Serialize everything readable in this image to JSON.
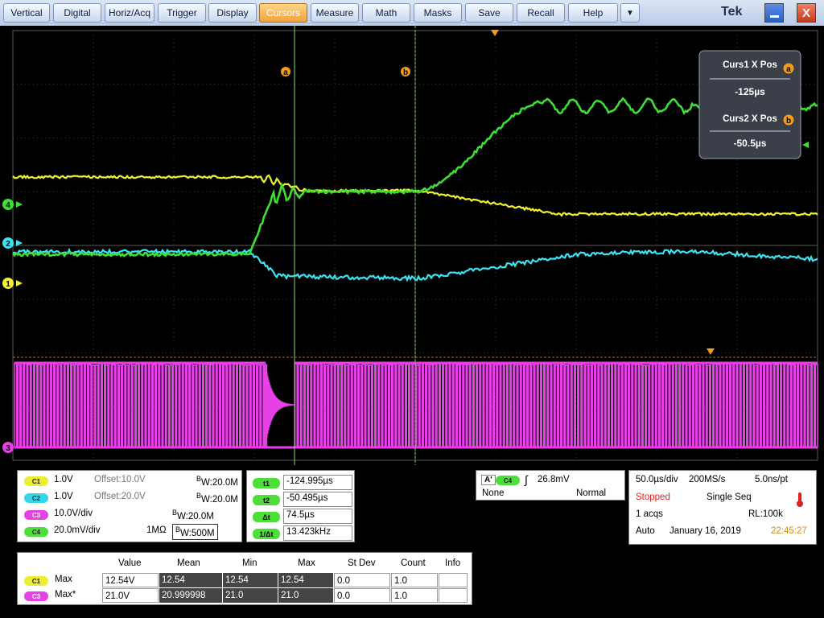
{
  "menu": {
    "items": [
      "Vertical",
      "Digital",
      "Horiz/Acq",
      "Trigger",
      "Display",
      "Cursors",
      "Measure",
      "Math",
      "Masks",
      "Save",
      "Recall",
      "Help"
    ],
    "active": "Cursors",
    "more": "▼",
    "brand": "Tek",
    "minimize": "",
    "close": "X"
  },
  "colors": {
    "ch1": "#f2f233",
    "ch2": "#3ae4f2",
    "ch3": "#e640e6",
    "ch4": "#3ce032",
    "accent": "#f59a1a",
    "stopped": "#e02020"
  },
  "markers": {
    "ch4": "4",
    "ch2": "2",
    "ch1": "1",
    "ch3": "3",
    "cursor_a": "a",
    "cursor_b": "b"
  },
  "cursor_readout": {
    "curs1_title": "Curs1 X Pos",
    "curs1_badge": "a",
    "curs1_value": "-125µs",
    "curs2_title": "Curs2 X Pos",
    "curs2_badge": "b",
    "curs2_value": "-50.5µs"
  },
  "channels": [
    {
      "chip": "C1",
      "scale": "1.0V",
      "offset": "Offset:10.0V",
      "bw": "W:20.0M",
      "bw_b": "B"
    },
    {
      "chip": "C2",
      "scale": "1.0V",
      "offset": "Offset:20.0V",
      "bw": "W:20.0M",
      "bw_b": "B"
    },
    {
      "chip": "C3",
      "scale": "10.0V/div",
      "bw": "W:20.0M",
      "bw_b": "B"
    },
    {
      "chip": "C4",
      "scale": "20.0mV/div",
      "impedance": "1MΩ",
      "bw": "W:500M",
      "bw_b": "B"
    }
  ],
  "cursors": [
    {
      "label": "t1",
      "value": "-124.995µs"
    },
    {
      "label": "t2",
      "value": "-50.495µs"
    },
    {
      "label": "Δt",
      "value": "74.5µs"
    },
    {
      "label": "1/Δt",
      "value": "13.423kHz"
    }
  ],
  "trigger": {
    "a": "A'",
    "chip": "C4",
    "slope": "∫",
    "level": "26.8mV",
    "coupling": "None",
    "mode": "Normal"
  },
  "horizontal": {
    "scale": "50.0µs/div",
    "rate": "200MS/s",
    "resolution": "5.0ns/pt",
    "state": "Stopped",
    "seq": "Single Seq",
    "acqs": "1 acqs",
    "rl": "RL:100k",
    "auto": "Auto",
    "date": "January 16, 2019",
    "time": "22:45:27"
  },
  "measurements": {
    "headers": [
      "Value",
      "Mean",
      "Min",
      "Max",
      "St Dev",
      "Count",
      "Info"
    ],
    "rows": [
      {
        "chip": "C1",
        "name": "Max",
        "value": "12.54V",
        "mean": "12.54",
        "min": "12.54",
        "max": "12.54",
        "stdev": "0.0",
        "count": "1.0",
        "info": ""
      },
      {
        "chip": "C3",
        "name": "Max*",
        "value": "21.0V",
        "mean": "20.999998",
        "min": "21.0",
        "max": "21.0",
        "stdev": "0.0",
        "count": "1.0",
        "info": ""
      }
    ]
  }
}
